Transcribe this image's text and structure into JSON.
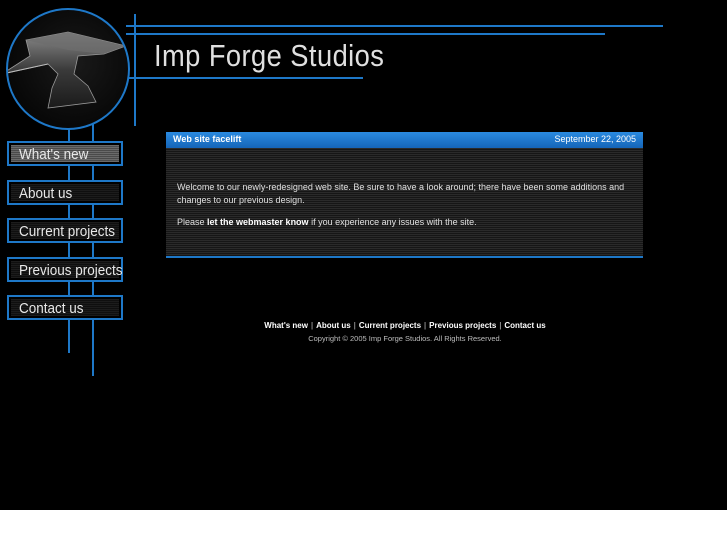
{
  "site": {
    "title": "Imp Forge Studios"
  },
  "nav": {
    "items": [
      {
        "label": "What's new",
        "active": true
      },
      {
        "label": "About us",
        "active": false
      },
      {
        "label": "Current projects",
        "active": false
      },
      {
        "label": "Previous projects",
        "active": false
      },
      {
        "label": "Contact us",
        "active": false
      }
    ]
  },
  "news": {
    "title": "Web site facelift",
    "date": "September 22, 2005",
    "paragraph1": "Welcome to our newly-redesigned web site. Be sure to have a look around; there have been some additions and changes to our previous design.",
    "paragraph2_before": "Please ",
    "paragraph2_link": "let the webmaster know",
    "paragraph2_after": " if you experience any issues with the site."
  },
  "footer": {
    "links": [
      "What's new",
      "About us",
      "Current projects",
      "Previous projects",
      "Contact us"
    ],
    "separator": "|",
    "copyright": "Copyright © 2005 Imp Forge Studios. All Rights Reserved."
  },
  "colors": {
    "accent": "#1e78c8",
    "background": "#000000",
    "header_bar": "#1a6ec4"
  },
  "icons": {
    "logo": "anvil-icon"
  }
}
